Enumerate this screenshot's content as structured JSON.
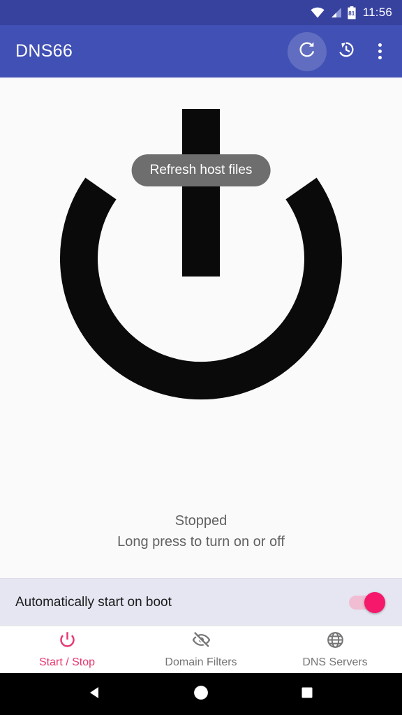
{
  "statusbar": {
    "time": "11:56",
    "battery_level": "81",
    "icons": [
      "wifi-icon",
      "cellular-signal-icon",
      "battery-icon"
    ]
  },
  "appbar": {
    "title": "DNS66",
    "actions": [
      {
        "name": "refresh-host-files-button",
        "icon": "refresh-icon",
        "pressed": true
      },
      {
        "name": "history-button",
        "icon": "history-icon",
        "pressed": false
      },
      {
        "name": "overflow-menu-button",
        "icon": "more-vertical-icon",
        "pressed": false
      }
    ],
    "background_color": "#4150B4"
  },
  "tooltip": {
    "text": "Refresh host files",
    "background_color": "#6e6e6e"
  },
  "main": {
    "power_button": {
      "name": "power-toggle-button",
      "state": "off",
      "color": "#0a0a0a"
    },
    "status_text": "Stopped",
    "status_hint": "Long press to turn on or off"
  },
  "boot_row": {
    "label": "Automatically start on boot",
    "toggle": {
      "checked": true,
      "track_color": "#F1BDD2",
      "thumb_color": "#F5186B"
    },
    "background_color": "#E5E6F2"
  },
  "bottom_nav": {
    "items": [
      {
        "label": "Start / Stop",
        "icon": "power-icon",
        "active": true
      },
      {
        "label": "Domain Filters",
        "icon": "eye-off-icon",
        "active": false
      },
      {
        "label": "DNS Servers",
        "icon": "globe-icon",
        "active": false
      }
    ],
    "active_color": "#E5396F",
    "inactive_color": "#757575"
  },
  "system_nav": {
    "buttons": [
      {
        "name": "back-button",
        "icon": "triangle-back-icon"
      },
      {
        "name": "home-button",
        "icon": "circle-home-icon"
      },
      {
        "name": "recents-button",
        "icon": "square-recents-icon"
      }
    ]
  }
}
